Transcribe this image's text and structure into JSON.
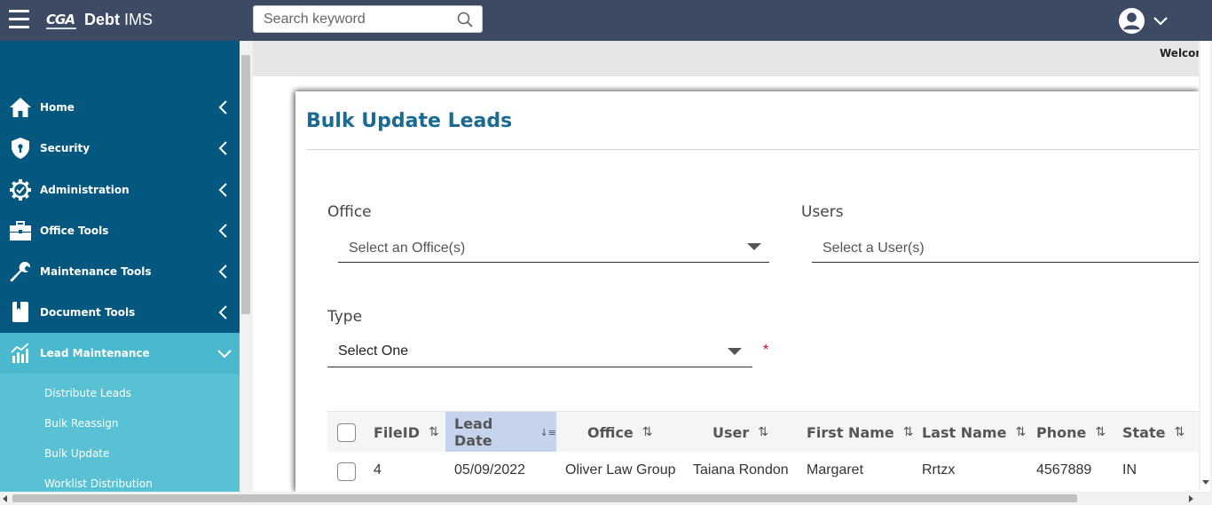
{
  "header": {
    "logo_text": "CGA",
    "app_title_bold": "Debt",
    "app_title_rest": " IMS",
    "search_placeholder": "Search keyword"
  },
  "sidebar": {
    "items": [
      {
        "label": "Home",
        "icon": "home-icon"
      },
      {
        "label": "Security",
        "icon": "shield-icon"
      },
      {
        "label": "Administration",
        "icon": "gear-icon"
      },
      {
        "label": "Office Tools",
        "icon": "briefcase-icon"
      },
      {
        "label": "Maintenance Tools",
        "icon": "wrench-icon"
      },
      {
        "label": "Document Tools",
        "icon": "book-icon"
      },
      {
        "label": "Lead Maintenance",
        "icon": "chart-icon"
      }
    ],
    "subitems": [
      "Distribute Leads",
      "Bulk Reassign",
      "Bulk Update",
      "Worklist Distribution"
    ]
  },
  "welcome_text": "Welcome",
  "page": {
    "title": "Bulk Update Leads",
    "office_label": "Office",
    "office_placeholder": "Select an Office(s)",
    "users_label": "Users",
    "users_placeholder": "Select a User(s)",
    "type_label": "Type",
    "type_value": "Select One",
    "required_mark": "*"
  },
  "table": {
    "headers": [
      "FileID",
      "Lead Date",
      "Office",
      "User",
      "First Name",
      "Last Name",
      "Phone",
      "State"
    ],
    "sort_icon": "⇅",
    "sorted_icon": "↓≡",
    "rows": [
      [
        "4",
        "05/09/2022",
        "Oliver Law Group",
        "Taiana Rondon",
        "Margaret",
        "Rrtzx",
        "4567889",
        "IN"
      ]
    ]
  },
  "colors": {
    "topbar": "#3c4a63",
    "sidebar": "#04577f",
    "active_item": "#4ab8cd",
    "submenu": "#59c1d4",
    "title": "#1a6a94",
    "sorted_header": "#c5d3ec"
  }
}
